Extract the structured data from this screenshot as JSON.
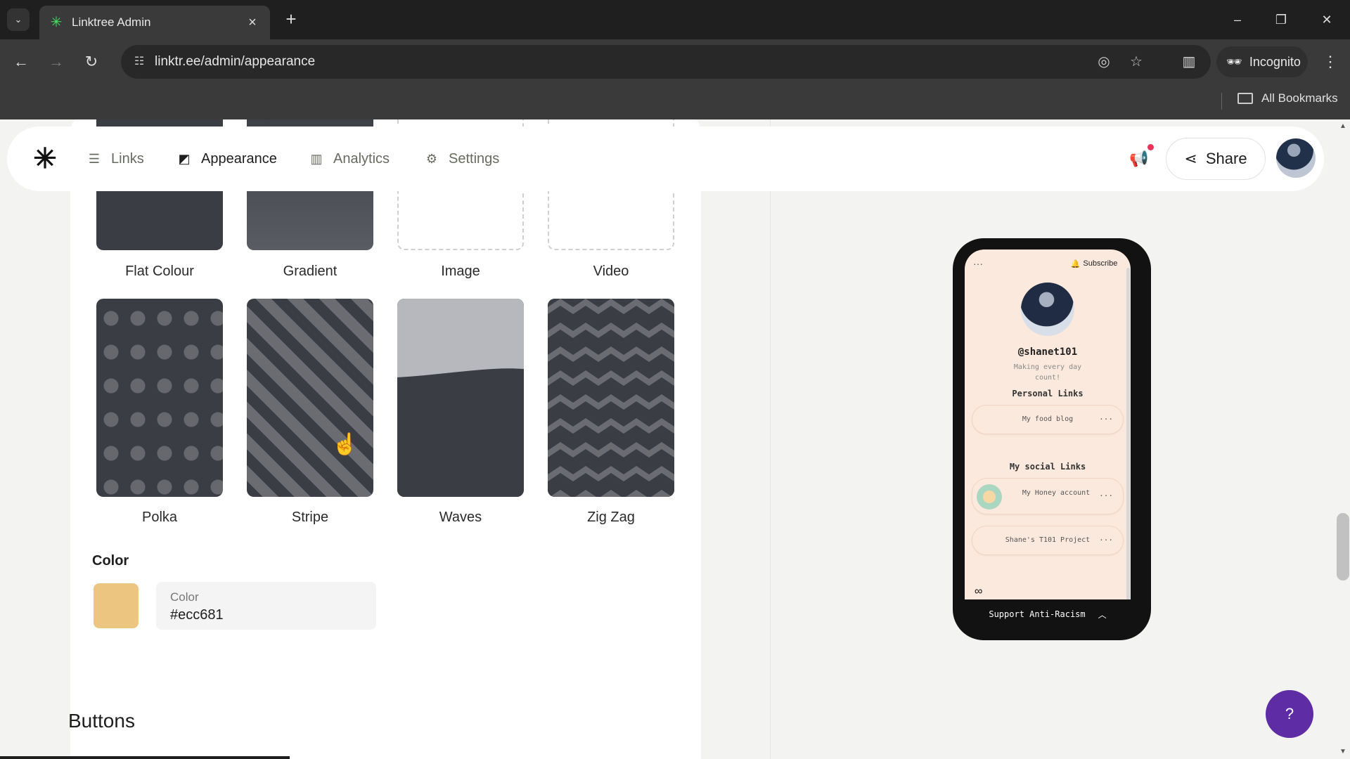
{
  "browser": {
    "tab_title": "Linktree Admin",
    "url": "linktr.ee/admin/appearance",
    "incognito_label": "Incognito",
    "all_bookmarks_label": "All Bookmarks",
    "tab_list_icon": "chevron-down-icon",
    "new_tab_icon": "plus-icon"
  },
  "nav": {
    "links_label": "Links",
    "appearance_label": "Appearance",
    "analytics_label": "Analytics",
    "settings_label": "Settings",
    "share_label": "Share",
    "active_item": "Appearance"
  },
  "backgrounds": {
    "options": [
      "Flat Colour",
      "Gradient",
      "Image",
      "Video",
      "Polka",
      "Stripe",
      "Waves",
      "Zig Zag"
    ]
  },
  "color": {
    "heading": "Color",
    "field_label": "Color",
    "value": "#ecc681",
    "swatch": "#ecc681"
  },
  "buttons_heading": "Buttons",
  "preview": {
    "subscribe_label": "Subscribe",
    "handle": "@shanet101",
    "bio": "Making every day count!",
    "section_personal": "Personal Links",
    "link_food_blog": "My food blog",
    "section_social": "My social Links",
    "link_honey": "My Honey account",
    "link_project": "Shane's T101 Project",
    "support_label": "Support Anti-Racism"
  },
  "help_label": "?",
  "colors": {
    "accent_purple": "#5e2ca5",
    "preview_bg": "#fbe9dd",
    "thumb_dark": "#3b3d44"
  }
}
